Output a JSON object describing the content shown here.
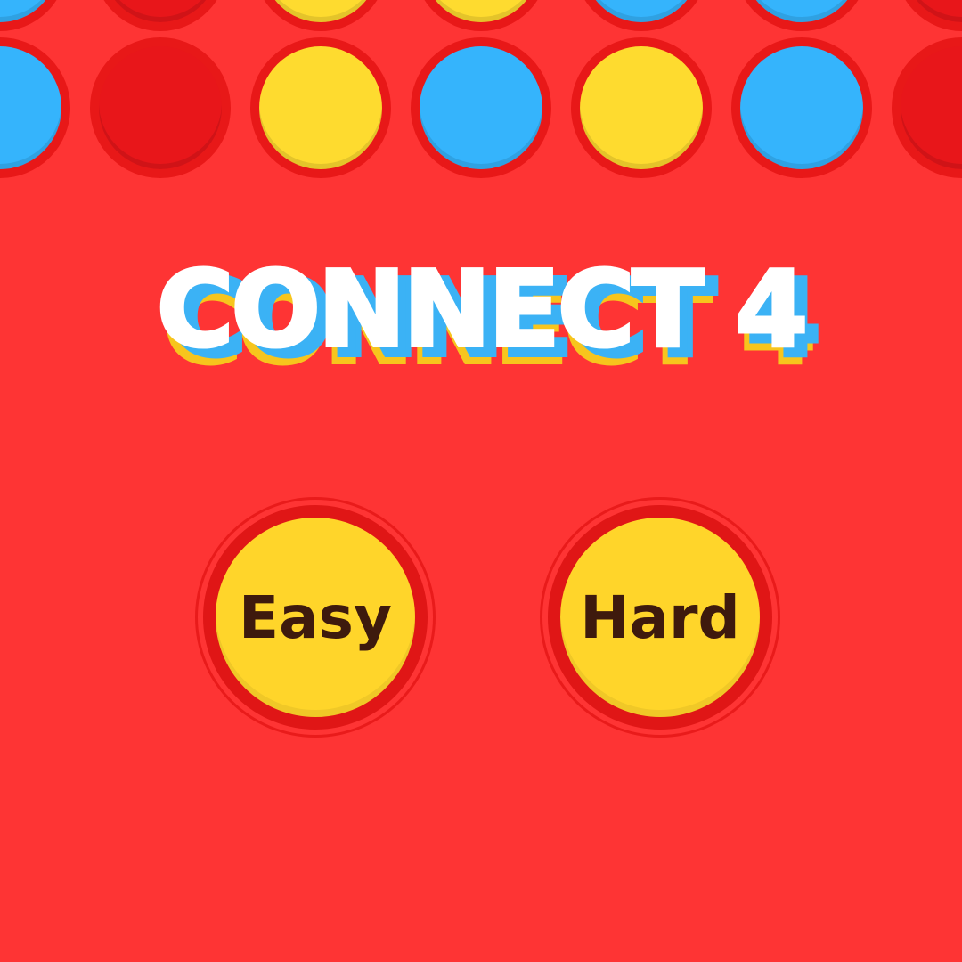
{
  "title": {
    "text": "CONNECT 4",
    "fill_color": "#ffffff",
    "shadow_colors": [
      "#3bb2f5",
      "#f7c51d"
    ]
  },
  "board": {
    "background_color": "#fe3434",
    "rows": [
      {
        "discs": [
          "blue",
          "red",
          "yellow",
          "yellow",
          "blue",
          "blue",
          "red"
        ]
      },
      {
        "discs": [
          "blue",
          "red",
          "yellow",
          "blue",
          "yellow",
          "blue",
          "red"
        ]
      }
    ],
    "colors": {
      "blue": "#35b4fc",
      "yellow": "#fedb2f",
      "red": "#e8161a"
    }
  },
  "difficulty": {
    "easy_label": "Easy",
    "hard_label": "Hard",
    "button_color": "#ffd52a",
    "text_color": "#3e1a0d"
  }
}
